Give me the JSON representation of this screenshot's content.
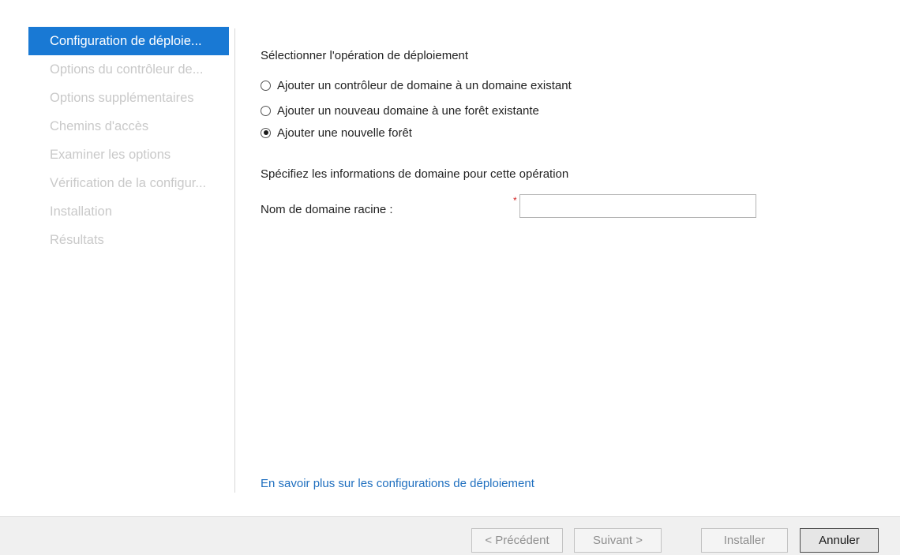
{
  "sidebar": {
    "items": [
      {
        "label": "Configuration de déploie...",
        "active": true
      },
      {
        "label": "Options du contrôleur de..."
      },
      {
        "label": "Options supplémentaires"
      },
      {
        "label": "Chemins d'accès"
      },
      {
        "label": "Examiner les options"
      },
      {
        "label": "Vérification de la configur..."
      },
      {
        "label": "Installation"
      },
      {
        "label": "Résultats"
      }
    ]
  },
  "main": {
    "operation_title": "Sélectionner l'opération de déploiement",
    "options": [
      {
        "label": "Ajouter un contrôleur de domaine à un domaine existant",
        "checked": false
      },
      {
        "label": "Ajouter un nouveau domaine à une forêt existante",
        "checked": false
      },
      {
        "label": "Ajouter une nouvelle forêt",
        "checked": true
      }
    ],
    "domain_info_title": "Spécifiez les informations de domaine pour cette opération",
    "root_domain_label": "Nom de domaine racine :",
    "root_domain_value": "",
    "required_mark": "*",
    "learn_more_link": "En savoir plus sur les configurations de déploiement"
  },
  "footer": {
    "previous_label": "< Précédent",
    "next_label": "Suivant >",
    "install_label": "Installer",
    "cancel_label": "Annuler"
  },
  "colors": {
    "accent": "#1979d4",
    "link": "#1f6fbf",
    "required": "#d21f1f",
    "disabled_text": "#c9c9c9"
  }
}
